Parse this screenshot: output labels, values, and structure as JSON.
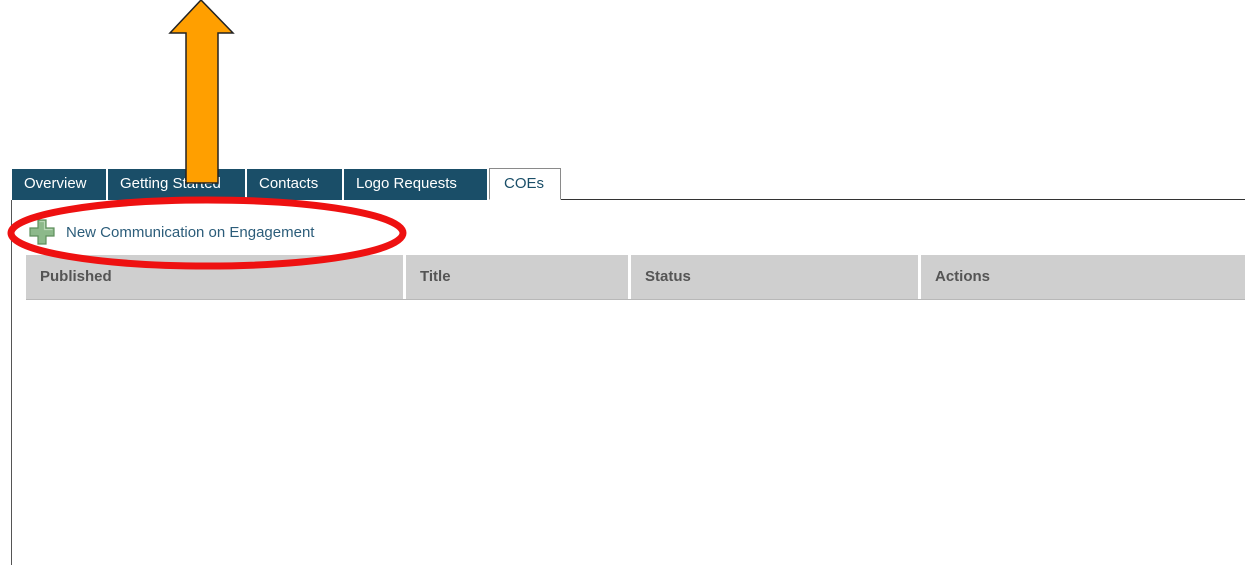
{
  "tabs": [
    {
      "label": "Overview",
      "active": false
    },
    {
      "label": "Getting Started",
      "active": false
    },
    {
      "label": "Contacts",
      "active": false
    },
    {
      "label": "Logo Requests",
      "active": false
    },
    {
      "label": "COEs",
      "active": true
    }
  ],
  "new_coe": {
    "label": "New Communication on Engagement",
    "icon": "plus-icon"
  },
  "table": {
    "columns": [
      "Published",
      "Title",
      "Status",
      "Actions"
    ],
    "rows": []
  },
  "colors": {
    "tab_bg": "#1a4e68",
    "link": "#2c5d7a",
    "header_bg": "#cfcfcf",
    "arrow": "#ff9f00",
    "highlight": "#ee1111"
  }
}
